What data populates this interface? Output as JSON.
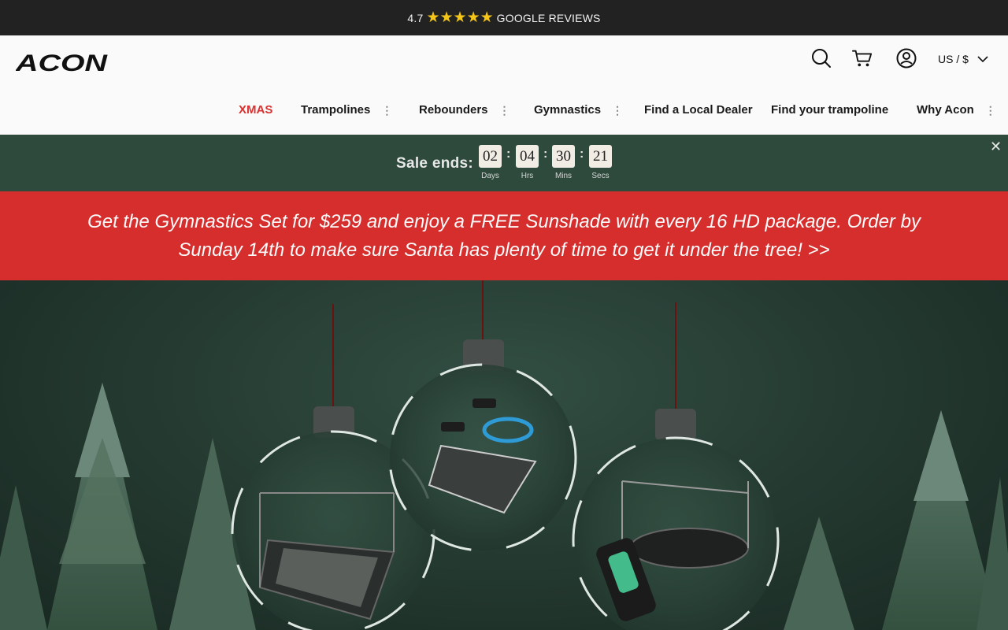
{
  "topbar": {
    "rating": "4.7",
    "stars_glyph": "★★★★★",
    "label": "GOOGLE REVIEWS"
  },
  "header": {
    "logo_alt": "ACON",
    "icons": [
      "search-icon",
      "cart-icon",
      "account-icon",
      "chevron-down-icon"
    ],
    "currency": "US / $"
  },
  "nav": {
    "items": [
      {
        "label": "XMAS",
        "has_menu": false
      },
      {
        "label": "Trampolines",
        "has_menu": true
      },
      {
        "label": "Rebounders",
        "has_menu": true
      },
      {
        "label": "Gymnastics",
        "has_menu": true
      },
      {
        "label": "Find a Local Dealer",
        "has_menu": false
      },
      {
        "label": "Find your trampoline",
        "has_menu": false
      },
      {
        "label": "Why Acon",
        "has_menu": true
      }
    ],
    "menu_glyph": "⋮"
  },
  "countdown": {
    "label": "Sale ends:",
    "units": [
      {
        "value": "02",
        "caption": "Days"
      },
      {
        "value": "04",
        "caption": "Hrs"
      },
      {
        "value": "30",
        "caption": "Mins"
      },
      {
        "value": "21",
        "caption": "Secs"
      }
    ],
    "separator": ":",
    "close_glyph": "✕"
  },
  "promo": {
    "text": "Get the Gymnastics Set for $259 and enjoy a FREE Sunshade with every 16 HD package. Order by Sunday 14th to make sure Santa has plenty of time to get it under the tree! >>"
  },
  "colors": {
    "topbar_bg": "#222222",
    "star": "#f5c518",
    "accent_red": "#d9312f",
    "countdown_bg": "#2d4a3d",
    "promo_bg": "#d52e2d"
  }
}
